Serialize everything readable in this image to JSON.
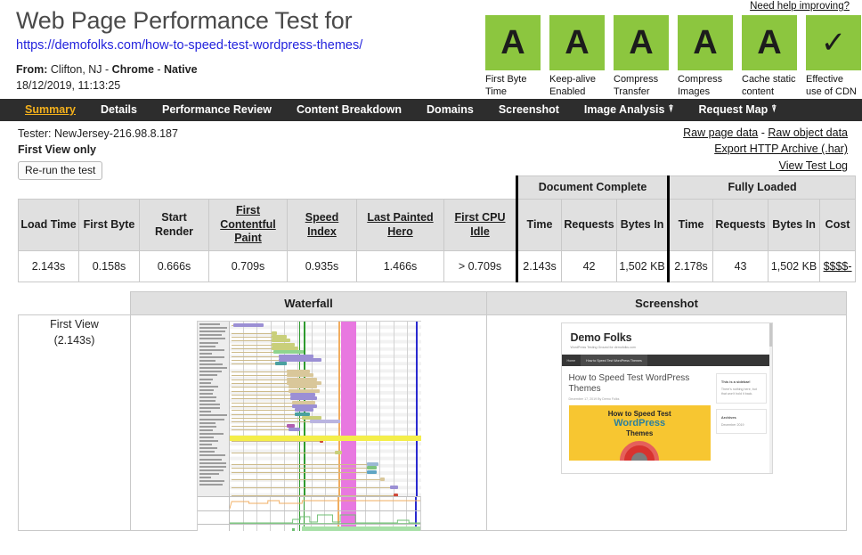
{
  "header": {
    "title": "Web Page Performance Test for",
    "url": "https://demofolks.com/how-to-speed-test-wordpress-themes/",
    "from_label": "From:",
    "from_value": "Clifton, NJ - Chrome - Native",
    "from_location": "Clifton, NJ",
    "from_browser": "Chrome",
    "from_connection": "Native",
    "date": "18/12/2019, 11:13:25",
    "help_link": "Need help improving?"
  },
  "grades": {
    "accent_green": "#8cc63f",
    "items": [
      {
        "grade": "A",
        "label": "First Byte Time",
        "is_check": false
      },
      {
        "grade": "A",
        "label": "Keep-alive Enabled",
        "is_check": false
      },
      {
        "grade": "A",
        "label": "Compress Transfer",
        "is_check": false
      },
      {
        "grade": "A",
        "label": "Compress Images",
        "is_check": false
      },
      {
        "grade": "A",
        "label": "Cache static content",
        "is_check": false
      },
      {
        "grade": "✓",
        "label": "Effective use of CDN",
        "is_check": true
      }
    ]
  },
  "nav": {
    "bar_color": "#2d2d2d",
    "active_color": "#f3b01c",
    "items": [
      {
        "label": "Summary",
        "active": true,
        "external": false
      },
      {
        "label": "Details",
        "active": false,
        "external": false
      },
      {
        "label": "Performance Review",
        "active": false,
        "external": false
      },
      {
        "label": "Content Breakdown",
        "active": false,
        "external": false
      },
      {
        "label": "Domains",
        "active": false,
        "external": false
      },
      {
        "label": "Screenshot",
        "active": false,
        "external": false
      },
      {
        "label": "Image Analysis",
        "active": false,
        "external": true
      },
      {
        "label": "Request Map",
        "active": false,
        "external": true
      }
    ],
    "external_icon": "external-link-icon"
  },
  "meta": {
    "tester": "Tester: NewJersey-216.98.8.187",
    "view_mode": "First View only",
    "rerun_button": "Re-run the test",
    "links": {
      "raw_page_data": "Raw page data",
      "separator": " - ",
      "raw_object_data": "Raw object data",
      "export_har": "Export HTTP Archive (.har)",
      "view_test_log": "View Test Log"
    }
  },
  "results_table": {
    "group_headers": [
      {
        "label": "Document Complete",
        "span": 3
      },
      {
        "label": "Fully Loaded",
        "span": 4
      }
    ],
    "columns": [
      {
        "label": "Load Time",
        "link": false
      },
      {
        "label": "First Byte",
        "link": false
      },
      {
        "label": "Start Render",
        "link": false
      },
      {
        "label": "First Contentful Paint",
        "link": true
      },
      {
        "label": "Speed Index",
        "link": true
      },
      {
        "label": "Last Painted Hero",
        "link": true
      },
      {
        "label": "First CPU Idle",
        "link": true
      },
      {
        "label": "Time",
        "link": false
      },
      {
        "label": "Requests",
        "link": false
      },
      {
        "label": "Bytes In",
        "link": false
      },
      {
        "label": "Time",
        "link": false
      },
      {
        "label": "Requests",
        "link": false
      },
      {
        "label": "Bytes In",
        "link": false
      },
      {
        "label": "Cost",
        "link": false
      }
    ],
    "row": [
      {
        "value": "2.143s",
        "link": false
      },
      {
        "value": "0.158s",
        "link": false
      },
      {
        "value": "0.666s",
        "link": false
      },
      {
        "value": "0.709s",
        "link": false
      },
      {
        "value": "0.935s",
        "link": false
      },
      {
        "value": "1.466s",
        "link": false
      },
      {
        "value": "> 0.709s",
        "link": false
      },
      {
        "value": "2.143s",
        "link": false
      },
      {
        "value": "42",
        "link": false
      },
      {
        "value": "1,502 KB",
        "link": false
      },
      {
        "value": "2.178s",
        "link": false
      },
      {
        "value": "43",
        "link": false
      },
      {
        "value": "1,502 KB",
        "link": false
      },
      {
        "value": "$$$$-",
        "link": true
      }
    ]
  },
  "waterfall_section": {
    "col_blank": "",
    "col_waterfall": "Waterfall",
    "col_screenshot": "Screenshot",
    "row_label_line1": "First View",
    "row_label_line2": "(2.143s)"
  },
  "screenshot_preview": {
    "site_title": "Demo Folks",
    "tagline": "WordPress Testing Ground for demofolks.com",
    "nav_home": "Home",
    "nav_current": "How to Speed Test WordPress Themes",
    "post_title": "How to Speed Test WordPress Themes",
    "post_meta": "December 17, 2019 By Demo Folks",
    "feature_line1": "How to Speed Test",
    "feature_line2": "WordPress",
    "feature_line3": "Themes",
    "widget1_title": "This is a sidebar!",
    "widget1_text": "There's nothing here, but that won't hold it back.",
    "widget2_title": "Archives",
    "widget2_text": "December 2019"
  },
  "chart_data": {
    "type": "waterfall",
    "title": "Waterfall",
    "requests_total": 43,
    "markers": {
      "start_render_s": 0.666,
      "first_contentful_paint_s": 0.709,
      "document_complete_s": 2.143,
      "fully_loaded_s": 2.178
    },
    "colors": {
      "dom_content_band": "#e878e0",
      "document_complete_line": "#f0ad60",
      "start_render_line": "#2f9b2f",
      "fully_loaded_line": "#2a2ad0",
      "highlight_row": "#f4ee4a",
      "cpu_utilization": "#f0ad60",
      "bandwidth_in": "#6fbf73"
    },
    "bars": [
      {
        "row": 0,
        "start_pct": 2,
        "width_pct": 16,
        "color": "#9b8fd4"
      },
      {
        "row": 2,
        "start_pct": 22,
        "width_pct": 3,
        "color": "#c9cf7a"
      },
      {
        "row": 3,
        "start_pct": 22,
        "width_pct": 8,
        "color": "#c9cf7a"
      },
      {
        "row": 4,
        "start_pct": 22,
        "width_pct": 10,
        "color": "#c9cf7a"
      },
      {
        "row": 5,
        "start_pct": 22,
        "width_pct": 12,
        "color": "#c9cf7a"
      },
      {
        "row": 6,
        "start_pct": 22,
        "width_pct": 14,
        "color": "#c9cf7a"
      },
      {
        "row": 7,
        "start_pct": 23,
        "width_pct": 16,
        "color": "#8fd48f"
      },
      {
        "row": 8,
        "start_pct": 26,
        "width_pct": 18,
        "color": "#9b8fd4"
      },
      {
        "row": 9,
        "start_pct": 26,
        "width_pct": 22,
        "color": "#9b8fd4"
      },
      {
        "row": 10,
        "start_pct": 24,
        "width_pct": 6,
        "color": "#4aa0a0"
      },
      {
        "row": 12,
        "start_pct": 30,
        "width_pct": 12,
        "color": "#d9c79a"
      },
      {
        "row": 13,
        "start_pct": 30,
        "width_pct": 14,
        "color": "#d9c79a"
      },
      {
        "row": 14,
        "start_pct": 30,
        "width_pct": 16,
        "color": "#d9c79a"
      },
      {
        "row": 15,
        "start_pct": 30,
        "width_pct": 18,
        "color": "#d9c79a"
      },
      {
        "row": 16,
        "start_pct": 31,
        "width_pct": 15,
        "color": "#d9c79a"
      },
      {
        "row": 17,
        "start_pct": 31,
        "width_pct": 16,
        "color": "#d9c79a"
      },
      {
        "row": 18,
        "start_pct": 32,
        "width_pct": 13,
        "color": "#9b8fd4"
      },
      {
        "row": 19,
        "start_pct": 32,
        "width_pct": 14,
        "color": "#9b8fd4"
      },
      {
        "row": 20,
        "start_pct": 33,
        "width_pct": 12,
        "color": "#d9c79a"
      },
      {
        "row": 21,
        "start_pct": 33,
        "width_pct": 13,
        "color": "#9b8fd4"
      },
      {
        "row": 22,
        "start_pct": 34,
        "width_pct": 10,
        "color": "#9b8fd4"
      },
      {
        "row": 23,
        "start_pct": 34,
        "width_pct": 8,
        "color": "#4aa0a0"
      },
      {
        "row": 24,
        "start_pct": 38,
        "width_pct": 10,
        "color": "#c9cf7a"
      },
      {
        "row": 25,
        "start_pct": 42,
        "width_pct": 16,
        "color": "#b9b4e0"
      },
      {
        "row": 26,
        "start_pct": 30,
        "width_pct": 4,
        "color": "#b05fb0"
      },
      {
        "row": 27,
        "start_pct": 31,
        "width_pct": 6,
        "color": "#9b8fd4"
      },
      {
        "row": 29,
        "start_pct": 46,
        "width_pct": 2,
        "color": "#d04a3a"
      },
      {
        "row": 30,
        "start_pct": 47,
        "width_pct": 2,
        "color": "#d04a3a"
      },
      {
        "row": 33,
        "start_pct": 55,
        "width_pct": 4,
        "color": "#c9cf7a"
      },
      {
        "row": 36,
        "start_pct": 72,
        "width_pct": 6,
        "color": "#9bb9d4"
      },
      {
        "row": 37,
        "start_pct": 72,
        "width_pct": 5,
        "color": "#7ec47e"
      },
      {
        "row": 38,
        "start_pct": 72,
        "width_pct": 5,
        "color": "#5fa5c4"
      },
      {
        "row": 40,
        "start_pct": 79,
        "width_pct": 2,
        "color": "#d9c79a"
      },
      {
        "row": 42,
        "start_pct": 84,
        "width_pct": 4,
        "color": "#9b8fd4"
      },
      {
        "row": 44,
        "start_pct": 86,
        "width_pct": 2,
        "color": "#d04a3a"
      }
    ]
  }
}
